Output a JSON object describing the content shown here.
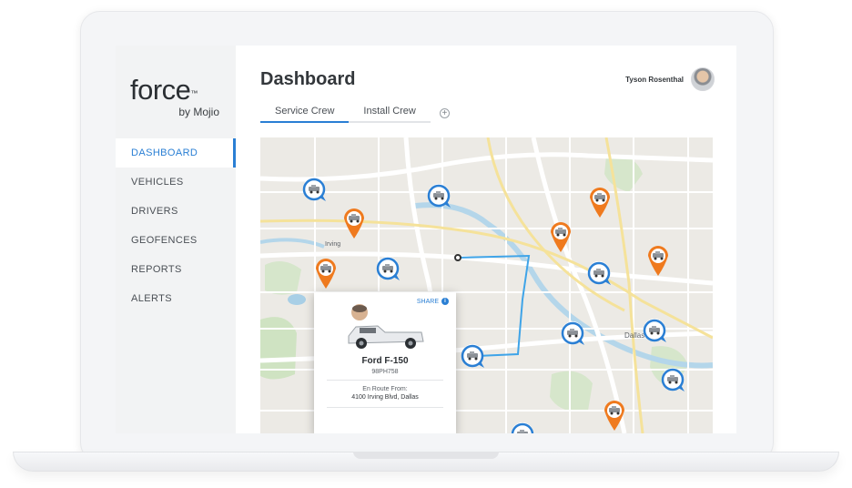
{
  "app": {
    "logo_main": "force",
    "logo_tm": "™",
    "logo_sub": "by Mojio"
  },
  "sidebar": {
    "items": [
      {
        "label": "DASHBOARD",
        "active": true
      },
      {
        "label": "VEHICLES",
        "active": false
      },
      {
        "label": "DRIVERS",
        "active": false
      },
      {
        "label": "GEOFENCES",
        "active": false
      },
      {
        "label": "REPORTS",
        "active": false
      },
      {
        "label": "ALERTS",
        "active": false
      }
    ]
  },
  "header": {
    "title": "Dashboard",
    "user_name": "Tyson Rosenthal"
  },
  "tabs": [
    {
      "label": "Service Crew",
      "active": true
    },
    {
      "label": "Install Crew",
      "active": false
    }
  ],
  "tab_add_icon": "plus-circle-icon",
  "map": {
    "labels": [
      "Irving",
      "Dallas"
    ],
    "colors": {
      "orange_pin": "#ef7a1e",
      "blue_pin": "#2a7fd4",
      "route": "#3fa4e8",
      "water": "#a8cfe6",
      "park": "#cfe3c2",
      "road_major": "#ffffff",
      "road_highway": "#f7e7a6"
    }
  },
  "card": {
    "share_label": "SHARE",
    "share_icon": "info-icon",
    "vehicle_name": "Ford F-150",
    "plate": "98PH758",
    "route_label": "En Route From:",
    "route_address": "4100 Irving Blvd, Dallas"
  },
  "colors": {
    "accent": "#2a7fd4",
    "sidebar_bg": "#f2f3f4"
  }
}
